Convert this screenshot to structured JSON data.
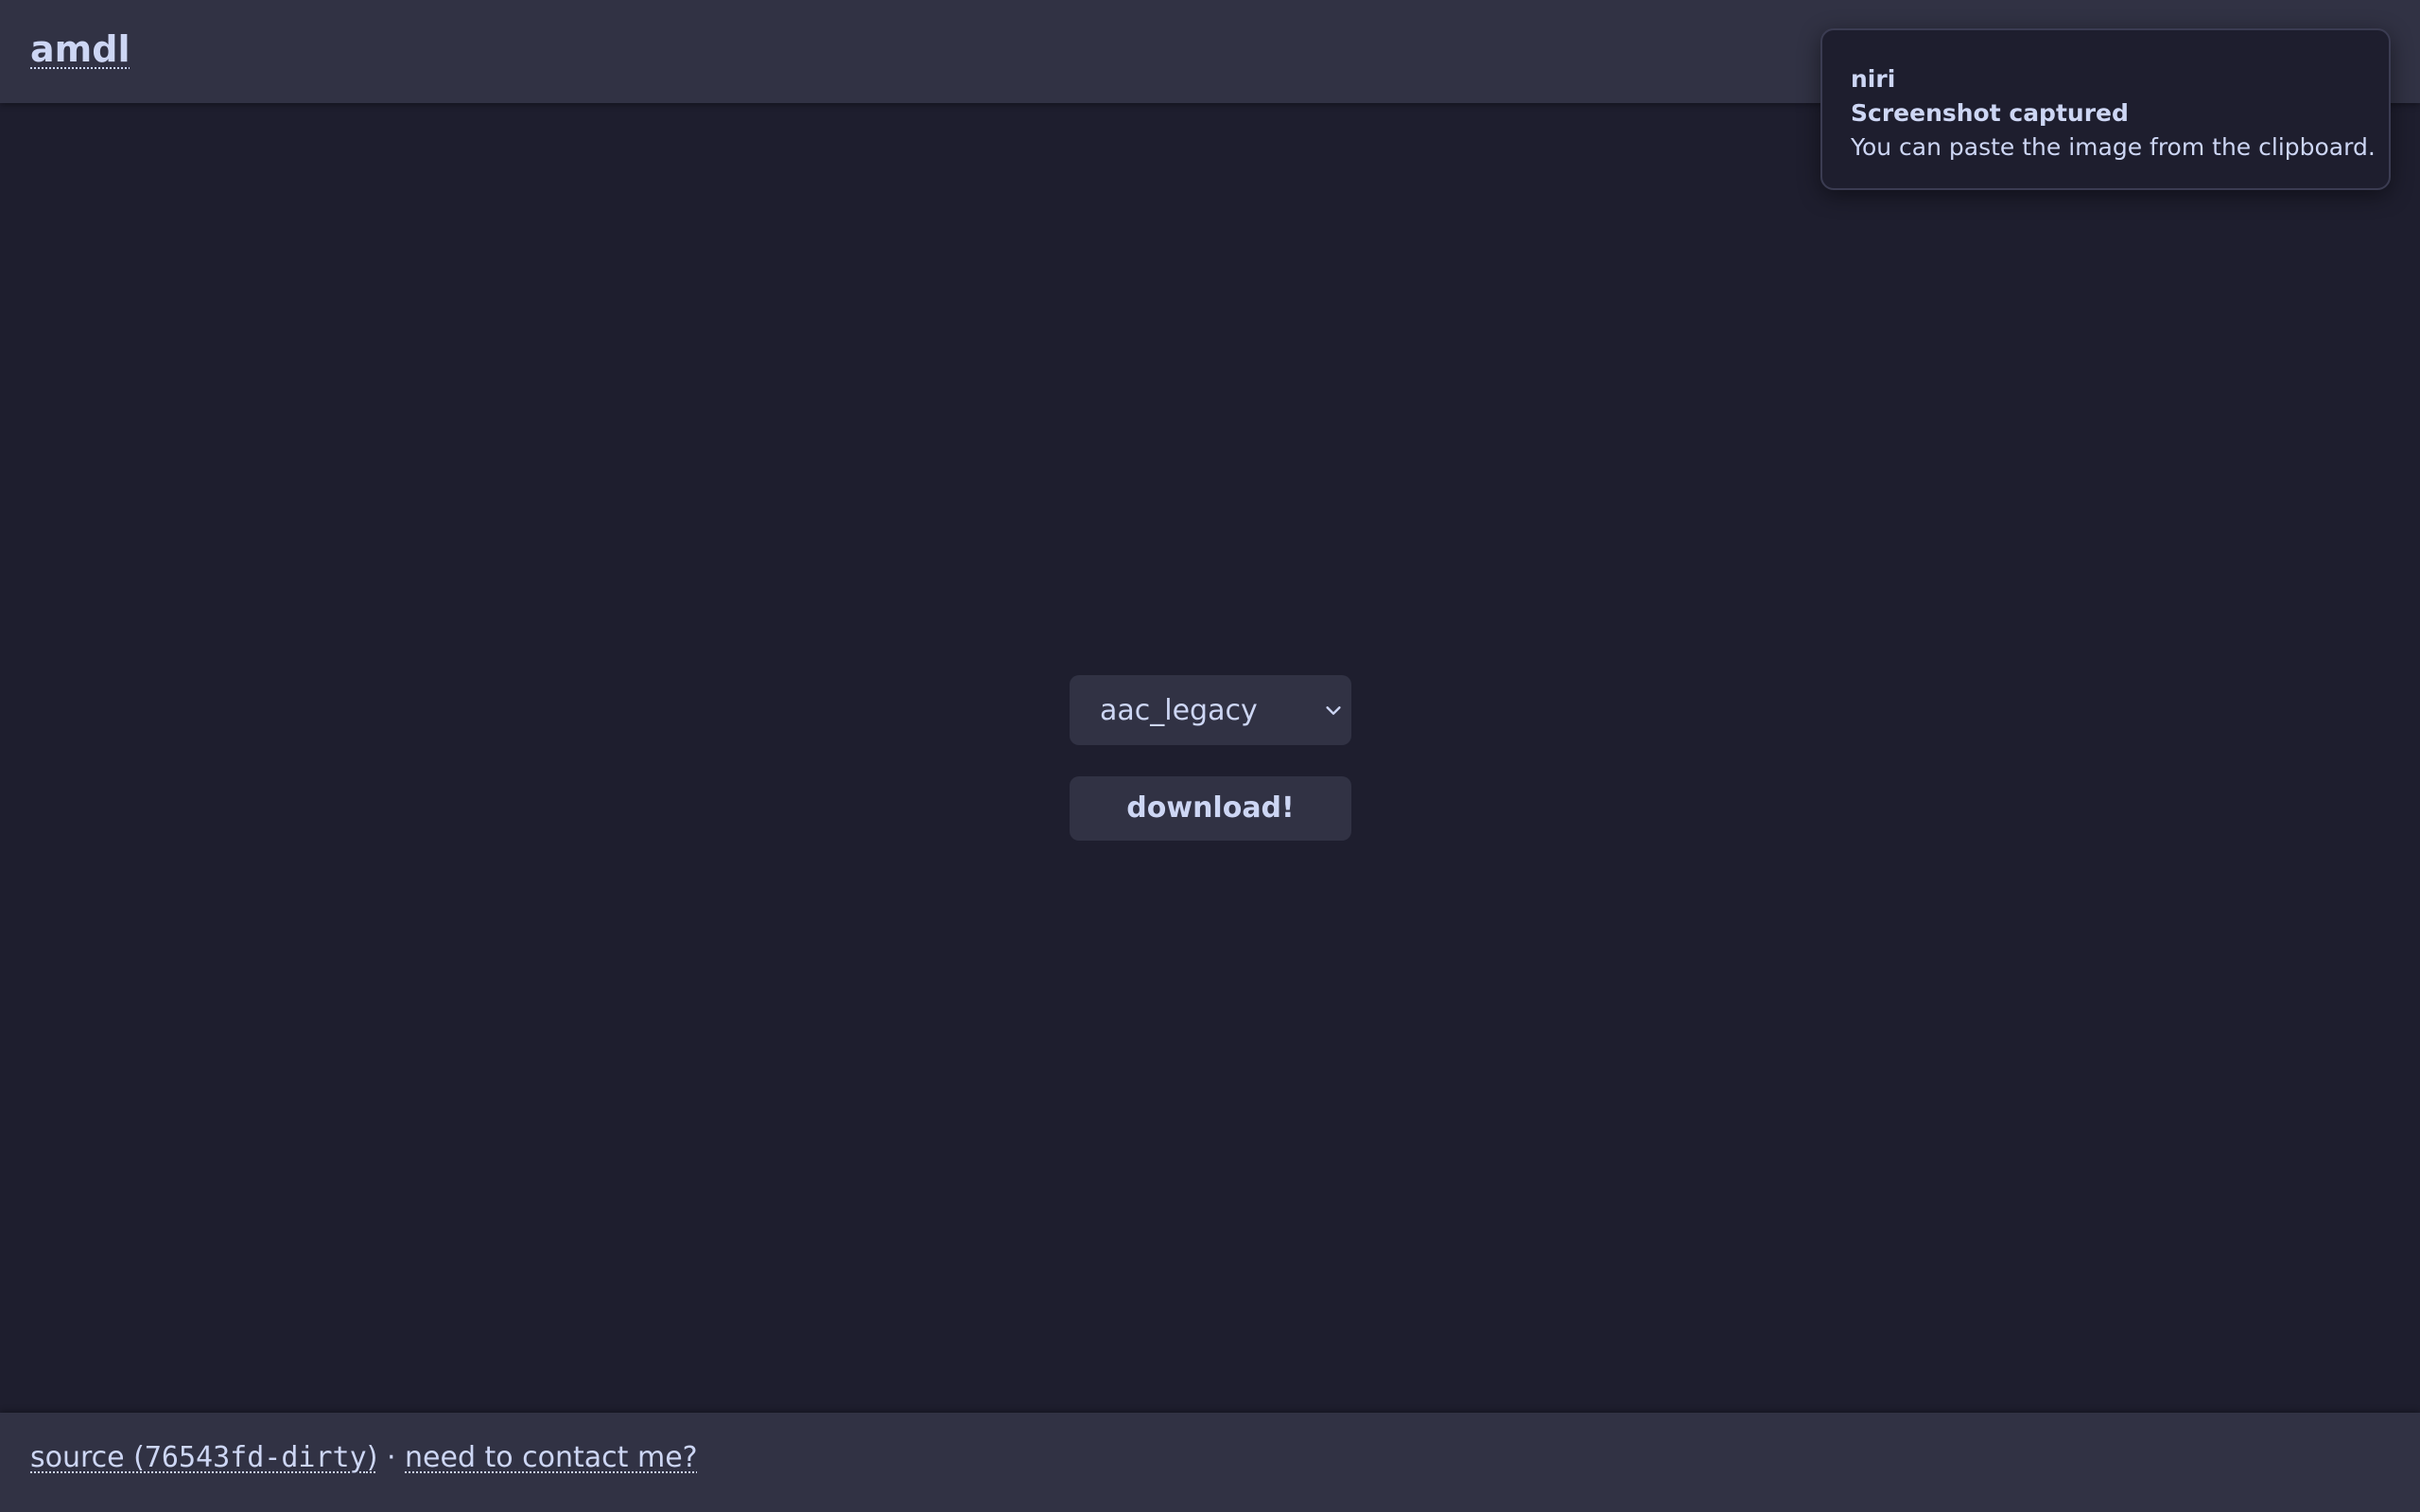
{
  "header": {
    "brand": "amdl"
  },
  "main": {
    "format_select": {
      "selected": "aac_legacy"
    },
    "download_label": "download!"
  },
  "footer": {
    "source_prefix": "source (",
    "commit": "76543fd-dirty",
    "source_suffix": ")",
    "separator": " · ",
    "contact_label": "need to contact me?"
  },
  "notification": {
    "app": "niri",
    "summary": "Screenshot captured",
    "body": "You can paste the image from the clipboard."
  },
  "icons": {
    "select_arrow": "chevron-down-icon"
  },
  "colors": {
    "background": "#1e1e2e",
    "surface": "#313244",
    "text": "#cdd6f4"
  }
}
